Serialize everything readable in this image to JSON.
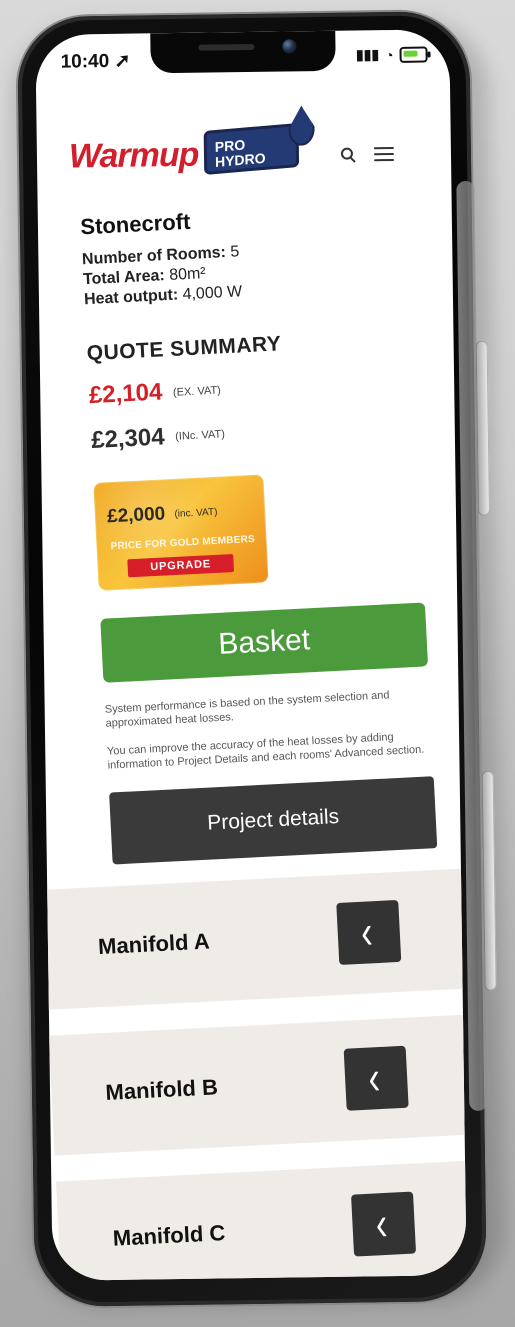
{
  "status_bar": {
    "time": "10:40",
    "location_icon": "location-arrow-icon",
    "signal_icon": "signal-icon",
    "wifi_icon": "wifi-icon",
    "battery_icon": "battery-icon"
  },
  "header": {
    "brand": "Warmup",
    "badge_line1": "PRO",
    "badge_line2": "HYDRO",
    "search_icon": "search-icon",
    "menu_icon": "menu-icon"
  },
  "project": {
    "name": "Stonecroft",
    "rooms_label": "Number of Rooms:",
    "rooms_value": "5",
    "area_label": "Total Area:",
    "area_value": "80m²",
    "heat_label": "Heat output:",
    "heat_value": "4,000 W"
  },
  "quote": {
    "title": "QUOTE SUMMARY",
    "ex_vat_price": "£2,104",
    "ex_vat_label": "(EX. VAT)",
    "inc_vat_price": "£2,304",
    "inc_vat_label": "(INc. VAT)"
  },
  "gold": {
    "price": "£2,000",
    "price_label": "(inc. VAT)",
    "subtitle": "PRICE FOR GOLD MEMBERS",
    "upgrade": "UPGRADE"
  },
  "actions": {
    "basket": "Basket",
    "project_details": "Project details"
  },
  "notes": {
    "line1": "System performance is based on the system selection and approximated heat losses.",
    "line2": "You can improve the accuracy of the heat losses by adding information to Project Details and each rooms' Advanced section."
  },
  "manifolds": [
    {
      "label": "Manifold A",
      "icon": "chevron-left-icon"
    },
    {
      "label": "Manifold B",
      "icon": "chevron-left-icon"
    },
    {
      "label": "Manifold C",
      "icon": "chevron-left-icon"
    }
  ],
  "colors": {
    "brand_red": "#d31f2b",
    "hydro_blue": "#243a74",
    "basket_green": "#4b9b3d",
    "gold_orange": "#f1aa23"
  }
}
